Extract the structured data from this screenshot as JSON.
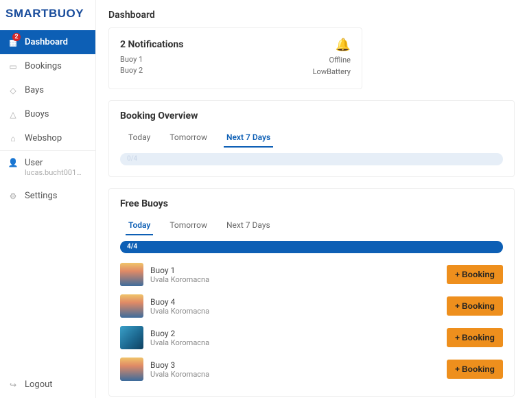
{
  "brand": "SMARTBUOY",
  "page_title": "Dashboard",
  "nav": {
    "badge": "2",
    "items": [
      {
        "label": "Dashboard",
        "active": true
      },
      {
        "label": "Bookings"
      },
      {
        "label": "Bays"
      },
      {
        "label": "Buoys"
      },
      {
        "label": "Webshop"
      }
    ],
    "user": {
      "label": "User",
      "email": "lucas.bucht001@gmail..."
    },
    "settings": "Settings",
    "logout": "Logout"
  },
  "notifications": {
    "title": "2 Notifications",
    "rows": [
      {
        "left": "Buoy 1",
        "right": "Offline"
      },
      {
        "left": "Buoy 2",
        "right": "LowBattery"
      }
    ]
  },
  "booking_overview": {
    "title": "Booking Overview",
    "tabs": {
      "today": "Today",
      "tomorrow": "Tomorrow",
      "next7": "Next 7 Days"
    },
    "active_tab": "next7",
    "progress_text": "0/4"
  },
  "free_buoys": {
    "title": "Free Buoys",
    "tabs": {
      "today": "Today",
      "tomorrow": "Tomorrow",
      "next7": "Next 7 Days"
    },
    "active_tab": "today",
    "progress_text": "4/4",
    "booking_label": "Booking",
    "items": [
      {
        "name": "Buoy 1",
        "sub": "Uvala Koromacna",
        "thumb": "sunset"
      },
      {
        "name": "Buoy 4",
        "sub": "Uvala Koromacna",
        "thumb": "sunset"
      },
      {
        "name": "Buoy 2",
        "sub": "Uvala Koromacna",
        "thumb": "coast"
      },
      {
        "name": "Buoy 3",
        "sub": "Uvala Koromacna",
        "thumb": "sunset"
      }
    ]
  }
}
